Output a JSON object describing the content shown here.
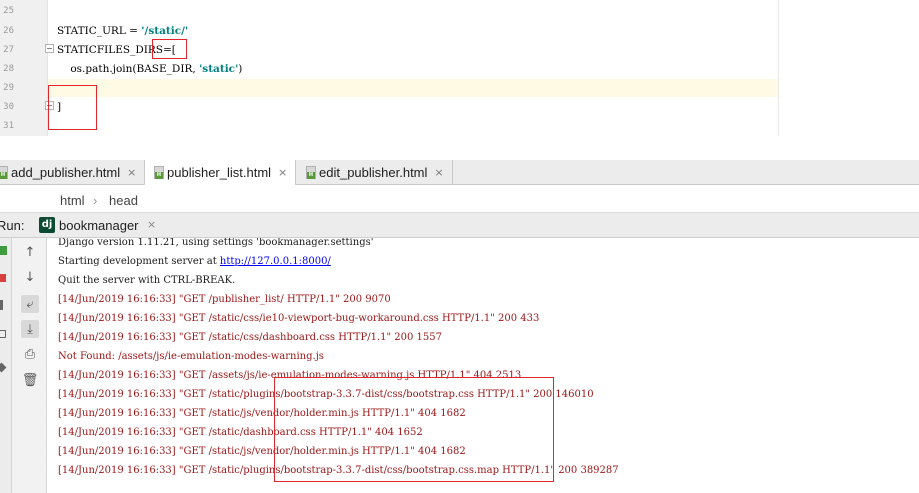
{
  "editor": {
    "line_numbers": [
      "25",
      "26",
      "27",
      "28",
      "29",
      "30",
      "31"
    ],
    "lines": {
      "static_url_prefix": "STATIC_URL = ",
      "static_url_value": "'/static/'",
      "dirs_prefix": "STATICFILES_DIRS",
      "dirs_suffix": "=[",
      "join_prefix": "    os.path.join(BASE_DIR, ",
      "join_value": "'static'",
      "join_suffix": ")",
      "close_bracket": "]"
    }
  },
  "tabs": [
    {
      "label": "add_publisher.html",
      "icon": "html-file-icon",
      "active": false
    },
    {
      "label": "publisher_list.html",
      "icon": "html-file-icon",
      "active": true
    },
    {
      "label": "edit_publisher.html",
      "icon": "html-file-icon",
      "active": false
    }
  ],
  "tab_close_glyph": "×",
  "breadcrumb": {
    "items": [
      "html",
      "head"
    ],
    "separator": "›"
  },
  "run": {
    "label": "Run:",
    "icon_text": "dj",
    "config": "bookmanager",
    "close_glyph": "×"
  },
  "console": {
    "lines": [
      "Django version 1.11.21, using settings 'bookmanager.settings'",
      "Starting development server at ",
      "Quit the server with CTRL-BREAK.",
      "[14/Jun/2019 16:16:33] \"GET /publisher_list/ HTTP/1.1\" 200 9070",
      "[14/Jun/2019 16:16:33] \"GET /static/css/ie10-viewport-bug-workaround.css HTTP/1.1\" 200 433",
      "[14/Jun/2019 16:16:33] \"GET /static/css/dashboard.css HTTP/1.1\" 200 1557",
      "Not Found: /assets/js/ie-emulation-modes-warning.js",
      "[14/Jun/2019 16:16:33] \"GET /assets/js/ie-emulation-modes-warning.js HTTP/1.1\" 404 2513",
      "[14/Jun/2019 16:16:33] \"GET /static/plugins/bootstrap-3.3.7-dist/css/bootstrap.css HTTP/1.1\" 200 146010",
      "[14/Jun/2019 16:16:33] \"GET /static/js/vendor/holder.min.js HTTP/1.1\" 404 1682",
      "[14/Jun/2019 16:16:33] \"GET /static/dashboard.css HTTP/1.1\" 404 1652",
      "[14/Jun/2019 16:16:33] \"GET /static/js/vendor/holder.min.js HTTP/1.1\" 404 1682",
      "[14/Jun/2019 16:16:33] \"GET /static/plugins/bootstrap-3.3.7-dist/css/bootstrap.css.map HTTP/1.1\" 200 389287"
    ],
    "server_url": "http://127.0.0.1:8000/"
  },
  "toolbar_icons": [
    "up-arrow-icon",
    "down-arrow-icon",
    "soft-wrap-icon",
    "scroll-to-end-icon",
    "print-icon",
    "trash-icon"
  ],
  "colors": {
    "log_text": "#9a1414",
    "link": "#0000ee",
    "string_literal": "#008080",
    "annotation_box": "#e0262b",
    "django_icon": "#0c4b33"
  }
}
